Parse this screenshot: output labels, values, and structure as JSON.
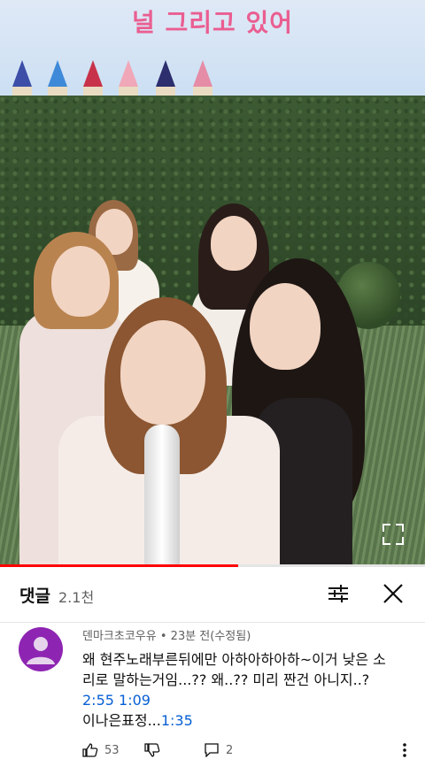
{
  "video": {
    "song_title": "널 그리고 있어",
    "progress_fraction": 0.56,
    "accent_color": "#ff0000"
  },
  "comments": {
    "header_title": "댓글",
    "count": "2.1천",
    "sort_icon": "sort-icon",
    "close_icon": "close-icon"
  },
  "comment": {
    "author": "덴마크초코우유",
    "separator": " • ",
    "time": "23분 전(수정됨)",
    "line1": "왜 현주노래부른뒤에만 아하아하아하~이거 낮은 소",
    "line2": "리로 말하는거임...?? 왜..?? 미리 짠건 아니지..?",
    "ts1": "2:55",
    "ts2": "1:09",
    "line4_text": "이나은표정...",
    "ts3": "1:35",
    "likes": "53",
    "replies": "2"
  }
}
